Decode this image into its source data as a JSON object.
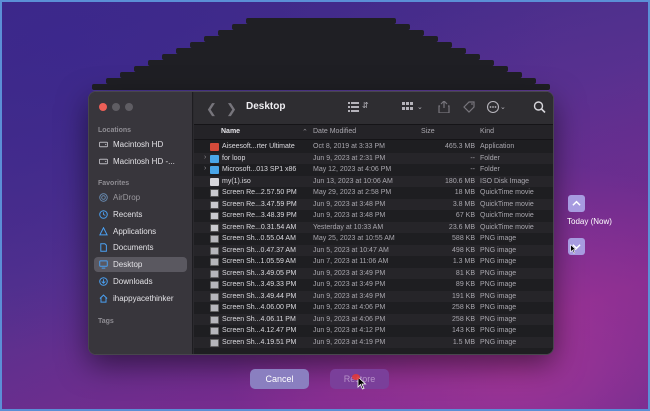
{
  "finder": {
    "title": "Desktop",
    "sidebar": {
      "locations_header": "Locations",
      "locations": [
        {
          "label": "Macintosh HD",
          "icon": "hard-drive-icon"
        },
        {
          "label": "Macintosh HD -...",
          "icon": "hard-drive-icon"
        }
      ],
      "favorites_header": "Favorites",
      "favorites": [
        {
          "label": "AirDrop",
          "icon": "airdrop-icon",
          "dim": true
        },
        {
          "label": "Recents",
          "icon": "clock-icon"
        },
        {
          "label": "Applications",
          "icon": "applications-icon"
        },
        {
          "label": "Documents",
          "icon": "document-icon"
        },
        {
          "label": "Desktop",
          "icon": "desktop-icon",
          "selected": true
        },
        {
          "label": "Downloads",
          "icon": "downloads-icon"
        },
        {
          "label": "ihappyacethinker",
          "icon": "home-icon"
        }
      ],
      "tags_header": "Tags"
    },
    "columns": {
      "name": "Name",
      "date": "Date Modified",
      "size": "Size",
      "kind": "Kind"
    },
    "files": [
      {
        "name": "Aiseesoft...rter Ultimate",
        "date": "Oct 8, 2019 at 3:33 PM",
        "size": "465.3 MB",
        "kind": "Application",
        "icon": "app"
      },
      {
        "name": "for loop",
        "date": "Jun 9, 2023 at 2:31 PM",
        "size": "--",
        "kind": "Folder",
        "icon": "folder"
      },
      {
        "name": "Microsoft...013 SP1 x86",
        "date": "May 12, 2023 at 4:06 PM",
        "size": "--",
        "kind": "Folder",
        "icon": "folder"
      },
      {
        "name": "my(1).iso",
        "date": "Jun 13, 2023 at 10:06 AM",
        "size": "180.6 MB",
        "kind": "ISO Disk Image",
        "icon": "iso"
      },
      {
        "name": "Screen Re...2.57.50 PM",
        "date": "May 29, 2023 at 2:58 PM",
        "size": "18 MB",
        "kind": "QuickTime movie",
        "icon": "movie"
      },
      {
        "name": "Screen Re...3.47.59 PM",
        "date": "Jun 9, 2023 at 3:48 PM",
        "size": "3.8 MB",
        "kind": "QuickTime movie",
        "icon": "movie"
      },
      {
        "name": "Screen Re...3.48.39 PM",
        "date": "Jun 9, 2023 at 3:48 PM",
        "size": "67 KB",
        "kind": "QuickTime movie",
        "icon": "movie"
      },
      {
        "name": "Screen Re...0.31.54 AM",
        "date": "Yesterday at 10:33 AM",
        "size": "23.6 MB",
        "kind": "QuickTime movie",
        "icon": "movie"
      },
      {
        "name": "Screen Sh...0.55.04 AM",
        "date": "May 25, 2023 at 10:55 AM",
        "size": "588 KB",
        "kind": "PNG image",
        "icon": "png"
      },
      {
        "name": "Screen Sh...0.47.37 AM",
        "date": "Jun 5, 2023 at 10:47 AM",
        "size": "498 KB",
        "kind": "PNG image",
        "icon": "png"
      },
      {
        "name": "Screen Sh...1.05.59 AM",
        "date": "Jun 7, 2023 at 11:06 AM",
        "size": "1.3 MB",
        "kind": "PNG image",
        "icon": "png"
      },
      {
        "name": "Screen Sh...3.49.05 PM",
        "date": "Jun 9, 2023 at 3:49 PM",
        "size": "81 KB",
        "kind": "PNG image",
        "icon": "png"
      },
      {
        "name": "Screen Sh...3.49.33 PM",
        "date": "Jun 9, 2023 at 3:49 PM",
        "size": "89 KB",
        "kind": "PNG image",
        "icon": "png"
      },
      {
        "name": "Screen Sh...3.49.44 PM",
        "date": "Jun 9, 2023 at 3:49 PM",
        "size": "191 KB",
        "kind": "PNG image",
        "icon": "png"
      },
      {
        "name": "Screen Sh...4.06.00 PM",
        "date": "Jun 9, 2023 at 4:06 PM",
        "size": "258 KB",
        "kind": "PNG image",
        "icon": "png"
      },
      {
        "name": "Screen Sh...4.06.11 PM",
        "date": "Jun 9, 2023 at 4:06 PM",
        "size": "258 KB",
        "kind": "PNG image",
        "icon": "png"
      },
      {
        "name": "Screen Sh...4.12.47 PM",
        "date": "Jun 9, 2023 at 4:12 PM",
        "size": "143 KB",
        "kind": "PNG image",
        "icon": "png"
      },
      {
        "name": "Screen Sh...4.19.51 PM",
        "date": "Jun 9, 2023 at 4:19 PM",
        "size": "1.5 MB",
        "kind": "PNG image",
        "icon": "png"
      }
    ]
  },
  "timeline": {
    "today_label": "Today (Now)"
  },
  "buttons": {
    "cancel": "Cancel",
    "restore": "Restore"
  }
}
